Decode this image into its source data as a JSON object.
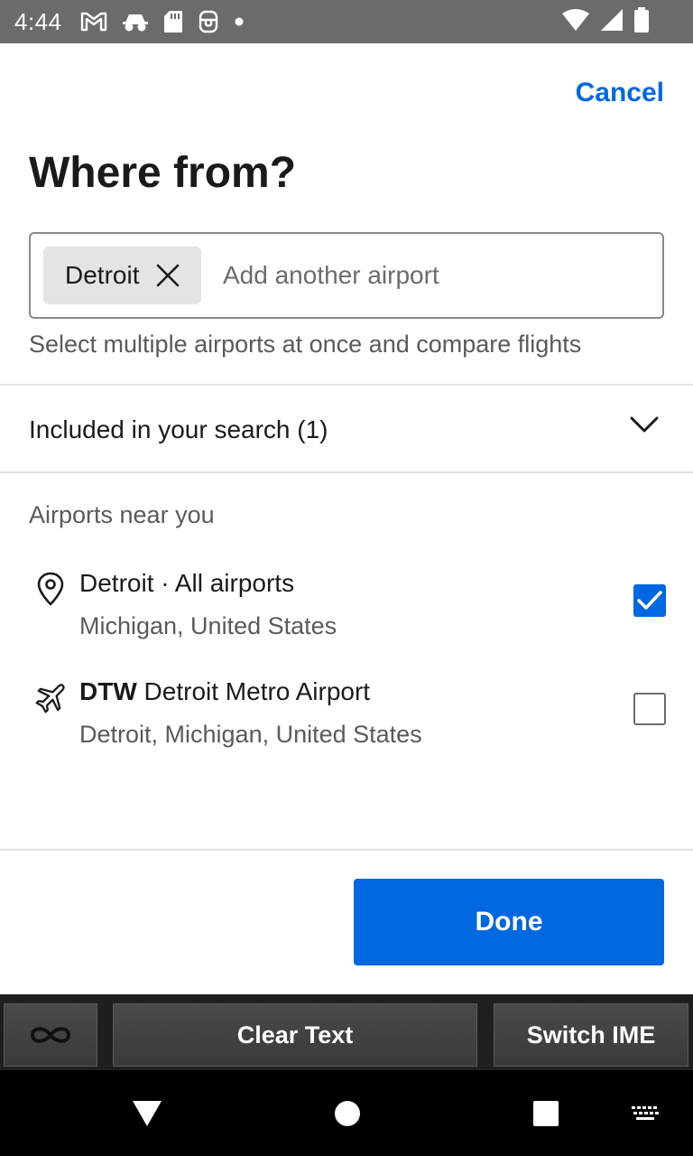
{
  "status_bar": {
    "time": "4:44",
    "icons": [
      "gmail-icon",
      "incognito-icon",
      "sd-card-icon",
      "vpn-icon",
      "dot-icon"
    ],
    "right_icons": [
      "wifi-icon",
      "cell-signal-icon",
      "battery-icon"
    ]
  },
  "header": {
    "cancel_label": "Cancel",
    "title": "Where from?"
  },
  "search": {
    "chip_label": "Detroit",
    "placeholder": "Add another airport",
    "value": "",
    "helper_text": "Select multiple airports at once and compare flights"
  },
  "included": {
    "label": "Included in your search (1)"
  },
  "nearby": {
    "section_title": "Airports near you",
    "items": [
      {
        "icon": "location-pin-icon",
        "code": "",
        "title": "Detroit · All airports",
        "subtitle": "Michigan, United States",
        "checked": true
      },
      {
        "icon": "airplane-icon",
        "code": "DTW",
        "title": "Detroit Metro Airport",
        "subtitle": "Detroit, Michigan, United States",
        "checked": false
      }
    ]
  },
  "footer": {
    "done_label": "Done"
  },
  "ime_bar": {
    "clear_label": "Clear Text",
    "switch_label": "Switch IME"
  },
  "colors": {
    "accent": "#0068e0",
    "status_bar": "#6b6b6b",
    "nav_bar": "#000000"
  }
}
